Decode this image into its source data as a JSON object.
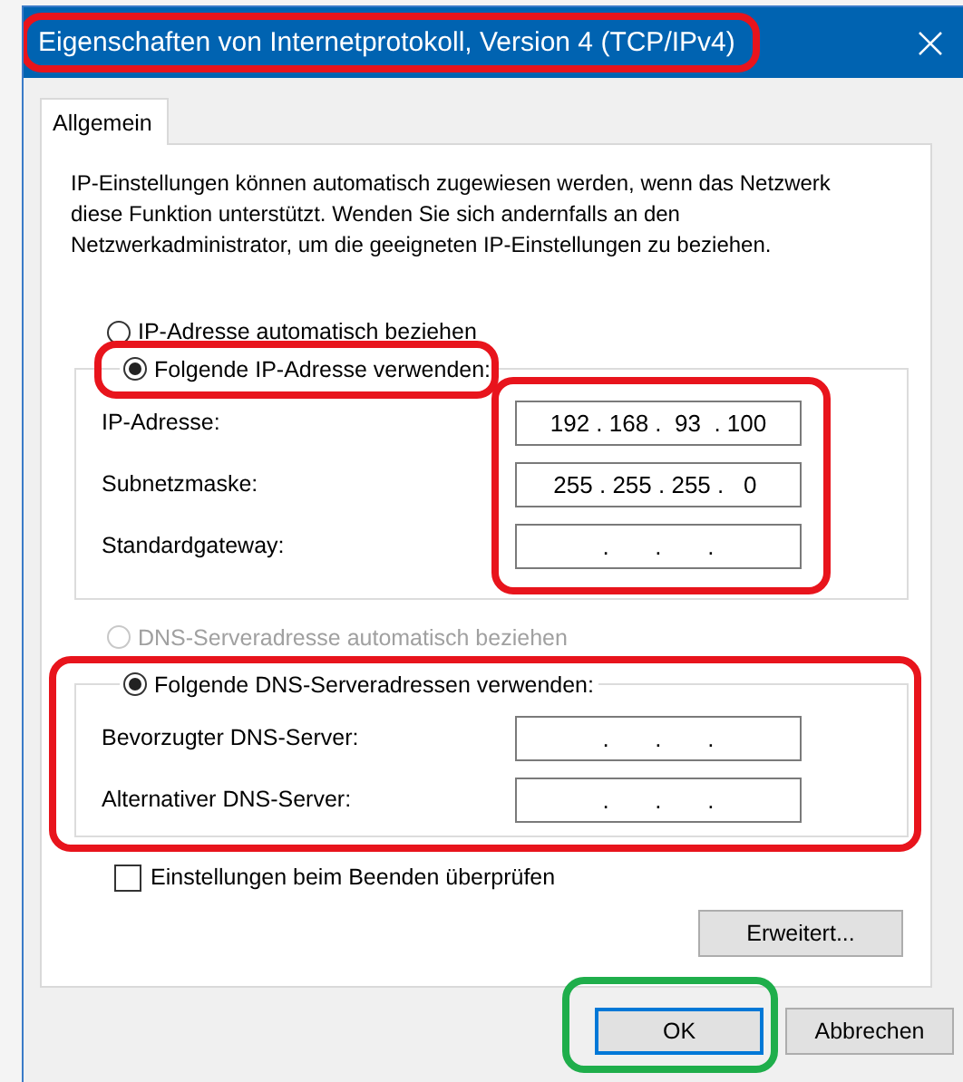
{
  "window": {
    "title": "Eigenschaften von Internetprotokoll, Version 4 (TCP/IPv4)",
    "color": "#e8141c"
  },
  "tabs": [
    {
      "label": "Allgemein",
      "selected": true
    }
  ],
  "description": "IP-Einstellungen können automatisch zugewiesen werden, wenn das Netzwerk diese Funktion unterstützt. Wenden Sie sich andernfalls an den Netzwerkadministrator, um die geeigneten IP-Einstellungen zu beziehen.",
  "ip_mode": [
    {
      "label": "IP-Adresse automatisch beziehen",
      "selected": false,
      "disabled": false
    },
    {
      "label": "Folgende IP-Adresse verwenden:",
      "selected": true,
      "disabled": false,
      "color": "#e8141c"
    }
  ],
  "ip_fields": {
    "color": "#e8141c",
    "rows": [
      {
        "label": "IP-Adresse:",
        "value": "192 . 168 .  93  . 100"
      },
      {
        "label": "Subnetzmaske:",
        "value": "255 . 255 . 255 .   0 "
      },
      {
        "label": "Standardgateway:",
        "value": "  .       .       .  "
      }
    ]
  },
  "dns_mode": [
    {
      "label": "DNS-Serveradresse automatisch beziehen",
      "selected": false,
      "disabled": true
    },
    {
      "label": "Folgende DNS-Serveradressen verwenden:",
      "selected": true,
      "disabled": false
    }
  ],
  "dns_fields": {
    "color": "#e8141c",
    "rows": [
      {
        "label": "Bevorzugter DNS-Server:",
        "value": "  .       .       .  "
      },
      {
        "label": "Alternativer DNS-Server:",
        "value": "  .       .       .  "
      }
    ]
  },
  "validate_on_exit": {
    "label": "Einstellungen beim Beenden überprüfen",
    "checked": false
  },
  "advanced_button": "Erweitert...",
  "buttons": [
    {
      "label": "OK",
      "default": true,
      "color": "#1fae4b"
    },
    {
      "label": "Abbrechen",
      "default": false
    }
  ]
}
